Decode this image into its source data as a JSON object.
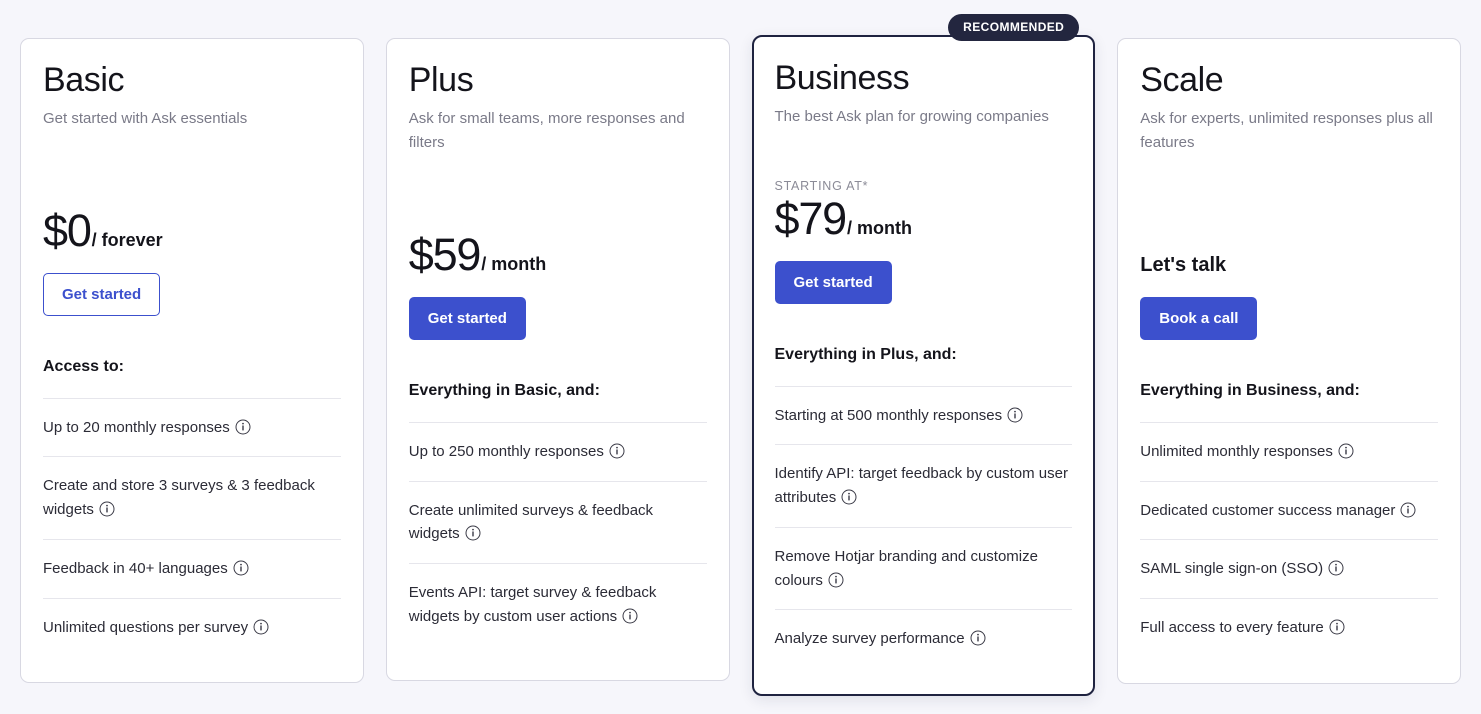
{
  "page": {
    "background_color": "#f6f6fb",
    "accent_color": "#3c50cd",
    "badge_color": "#23263f"
  },
  "icons": {
    "info": "info-circle-icon"
  },
  "plans": [
    {
      "id": "basic",
      "name": "Basic",
      "tagline": "Get started with Ask essentials",
      "price_prefix": "",
      "price_amount": "$0",
      "price_period": "/ forever",
      "price_text": "",
      "cta_label": "Get started",
      "cta_style": "outline",
      "recommended": false,
      "badge_label": "",
      "features_heading": "Access to:",
      "features": [
        "Up to 20 monthly responses",
        "Create and store 3 surveys & 3 feedback widgets",
        "Feedback in 40+ languages",
        "Unlimited questions per survey"
      ]
    },
    {
      "id": "plus",
      "name": "Plus",
      "tagline": "Ask for small teams, more responses and filters",
      "price_prefix": "",
      "price_amount": "$59",
      "price_period": "/ month",
      "price_text": "",
      "cta_label": "Get started",
      "cta_style": "filled",
      "recommended": false,
      "badge_label": "",
      "features_heading": "Everything in Basic, and:",
      "features": [
        "Up to 250 monthly responses",
        "Create unlimited surveys & feedback widgets",
        "Events API: target survey & feedback widgets by custom user actions"
      ]
    },
    {
      "id": "business",
      "name": "Business",
      "tagline": "The best Ask plan for growing companies",
      "price_prefix": "STARTING AT*",
      "price_amount": "$79",
      "price_period": "/ month",
      "price_text": "",
      "cta_label": "Get started",
      "cta_style": "filled",
      "recommended": true,
      "badge_label": "RECOMMENDED",
      "features_heading": "Everything in Plus, and:",
      "features": [
        "Starting at 500 monthly responses",
        "Identify API: target feedback by custom user attributes",
        "Remove Hotjar branding and customize colours",
        "Analyze survey performance"
      ]
    },
    {
      "id": "scale",
      "name": "Scale",
      "tagline": "Ask for experts, unlimited responses plus all features",
      "price_prefix": "",
      "price_amount": "",
      "price_period": "",
      "price_text": "Let's talk",
      "cta_label": "Book a call",
      "cta_style": "filled",
      "recommended": false,
      "badge_label": "",
      "features_heading": "Everything in Business, and:",
      "features": [
        "Unlimited monthly responses",
        "Dedicated customer success manager",
        "SAML single sign-on (SSO)",
        "Full access to every feature"
      ]
    }
  ]
}
